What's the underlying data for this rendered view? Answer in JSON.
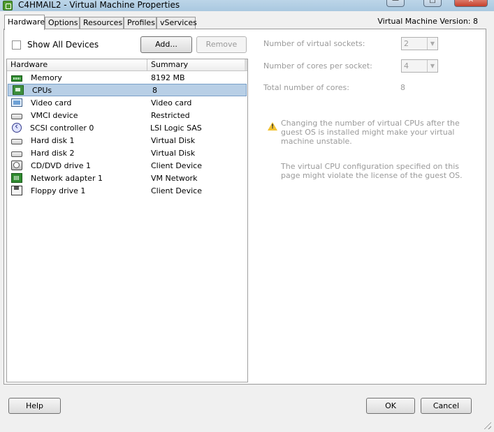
{
  "window": {
    "title": "C4HMAIL2 - Virtual Machine Properties",
    "min_glyph": "—",
    "max_glyph": "□",
    "close_glyph": "✕"
  },
  "tabs": [
    {
      "label": "Hardware",
      "active": true
    },
    {
      "label": "Options"
    },
    {
      "label": "Resources"
    },
    {
      "label": "Profiles"
    },
    {
      "label": "vServices"
    }
  ],
  "vm_version": "Virtual Machine Version: 8",
  "hardware_panel": {
    "show_all_label": "Show All Devices",
    "show_all_checked": false,
    "add_label": "Add...",
    "remove_label": "Remove",
    "columns": [
      "Hardware",
      "Summary"
    ],
    "rows": [
      {
        "icon": "memory-icon",
        "name": "Memory",
        "summary": "8192 MB"
      },
      {
        "icon": "cpu-icon",
        "name": "CPUs",
        "summary": "8",
        "selected": true
      },
      {
        "icon": "video-card-icon",
        "name": "Video card",
        "summary": "Video card"
      },
      {
        "icon": "vmci-device-icon",
        "name": "VMCI device",
        "summary": "Restricted"
      },
      {
        "icon": "scsi-controller-icon",
        "name": "SCSI controller 0",
        "summary": "LSI Logic SAS"
      },
      {
        "icon": "hard-disk-icon",
        "name": "Hard disk 1",
        "summary": "Virtual Disk"
      },
      {
        "icon": "hard-disk-icon",
        "name": "Hard disk 2",
        "summary": "Virtual Disk"
      },
      {
        "icon": "cd-dvd-drive-icon",
        "name": "CD/DVD drive 1",
        "summary": "Client Device"
      },
      {
        "icon": "network-adapter-icon",
        "name": "Network adapter 1",
        "summary": "VM Network"
      },
      {
        "icon": "floppy-drive-icon",
        "name": "Floppy drive 1",
        "summary": "Client Device"
      }
    ]
  },
  "cpu_settings": {
    "sockets_label": "Number of virtual sockets:",
    "sockets_value": "2",
    "cores_label": "Number of cores per socket:",
    "cores_value": "4",
    "total_label": "Total number of cores:",
    "total_value": "8",
    "warning_text": "Changing the number of virtual CPUs after the guest OS is installed might make your virtual machine unstable.",
    "license_text": "The virtual CPU configuration specified on this page might violate the license of the guest OS."
  },
  "footer": {
    "help_label": "Help",
    "ok_label": "OK",
    "cancel_label": "Cancel"
  }
}
